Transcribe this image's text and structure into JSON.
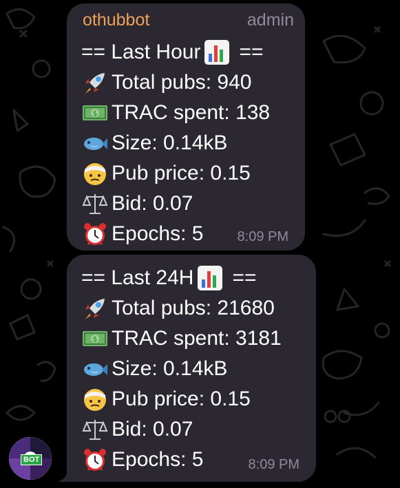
{
  "bot": {
    "name": "othubbot",
    "role": "admin",
    "avatar_badge": "BOT"
  },
  "messages": [
    {
      "heading_prefix": "== Last Hour",
      "heading_suffix": "==",
      "heading_icon": "bar-chart-icon",
      "stats": [
        {
          "icon": "rocket-icon",
          "text": "Total pubs: 940"
        },
        {
          "icon": "money-bill-icon",
          "text": "TRAC spent: 138"
        },
        {
          "icon": "fish-icon",
          "text": "Size: 0.14kB"
        },
        {
          "icon": "bandaged-face-icon",
          "text": "Pub price: 0.15"
        },
        {
          "icon": "balance-scale-icon",
          "text": "Bid: 0.07"
        },
        {
          "icon": "alarm-clock-icon",
          "text": "Epochs: 5"
        }
      ],
      "time": "8:09 PM"
    },
    {
      "heading_prefix": "== Last 24H",
      "heading_suffix": "==",
      "heading_icon": "bar-chart-icon",
      "stats": [
        {
          "icon": "rocket-icon",
          "text": "Total pubs: 21680"
        },
        {
          "icon": "money-bill-icon",
          "text": "TRAC spent: 3181"
        },
        {
          "icon": "fish-icon",
          "text": "Size: 0.14kB"
        },
        {
          "icon": "bandaged-face-icon",
          "text": "Pub price: 0.15"
        },
        {
          "icon": "balance-scale-icon",
          "text": "Bid: 0.07"
        },
        {
          "icon": "alarm-clock-icon",
          "text": "Epochs: 5"
        }
      ],
      "time": "8:09 PM"
    }
  ],
  "colors": {
    "background": "#000000",
    "bubble": "#2b2831",
    "sender_name": "#f0a25a",
    "muted": "#8f8b98",
    "text": "#ffffff"
  }
}
